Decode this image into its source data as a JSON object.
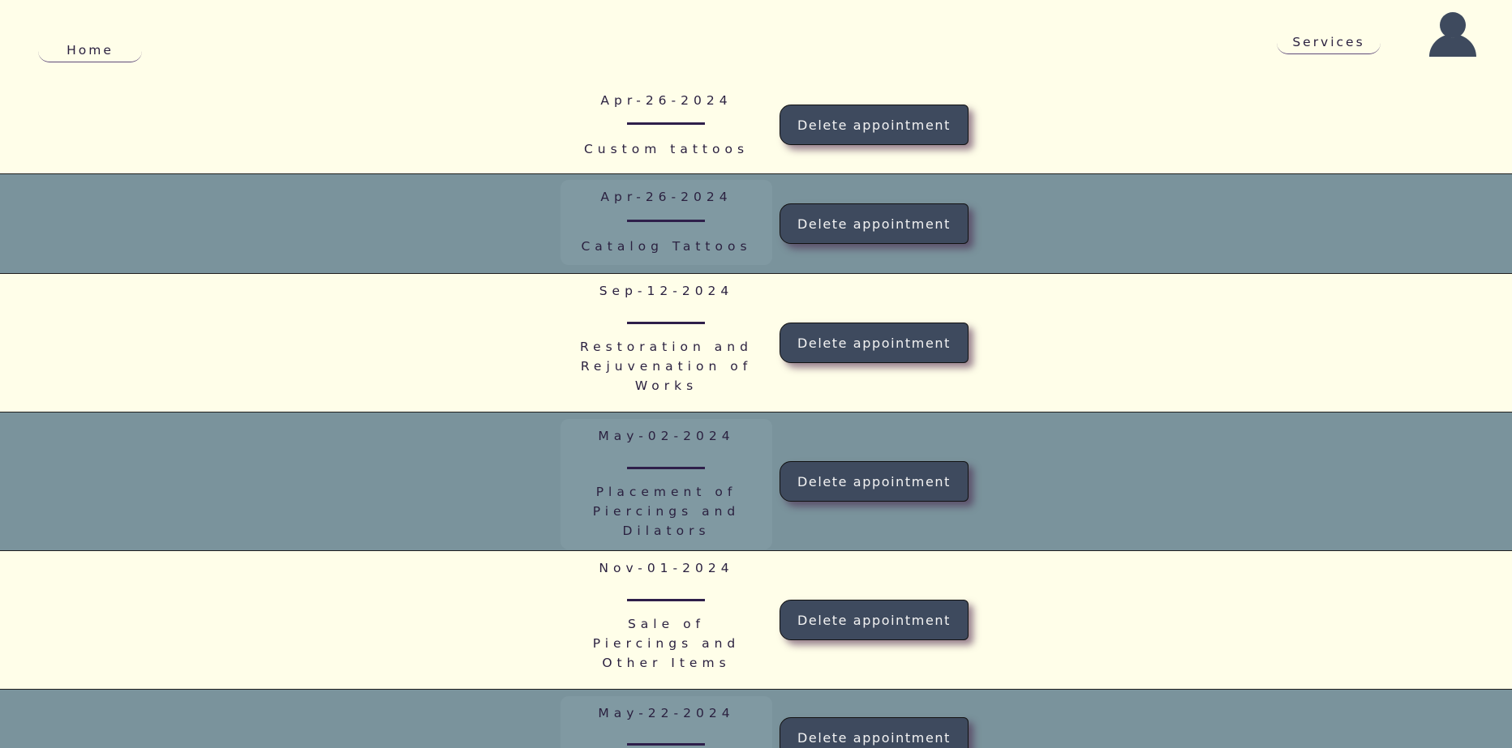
{
  "header": {
    "home_label": "Home",
    "services_label": "Services",
    "avatar_icon": "user-avatar-icon"
  },
  "appointments": [
    {
      "date": "Apr-26-2024",
      "service": "Custom tattoos",
      "button": "Delete appointment"
    },
    {
      "date": "Apr-26-2024",
      "service": "Catalog Tattoos",
      "button": "Delete appointment"
    },
    {
      "date": "Sep-12-2024",
      "service": "Restoration and\nRejuvenation of\nWorks",
      "button": "Delete appointment"
    },
    {
      "date": "May-02-2024",
      "service": "Placement of\nPiercings and\nDilators",
      "button": "Delete appointment"
    },
    {
      "date": "Nov-01-2024",
      "service": "Sale of\nPiercings and\nOther Items",
      "button": "Delete appointment"
    },
    {
      "date": "May-22-2024",
      "service": "",
      "button": "Delete appointment"
    }
  ],
  "colors": {
    "background": "#fffee9",
    "row_alt": "#7a939c",
    "card_alt": "#8099a2",
    "button": "#3e4a5e",
    "text": "#2b2140",
    "avatar": "#3e4a5e"
  }
}
